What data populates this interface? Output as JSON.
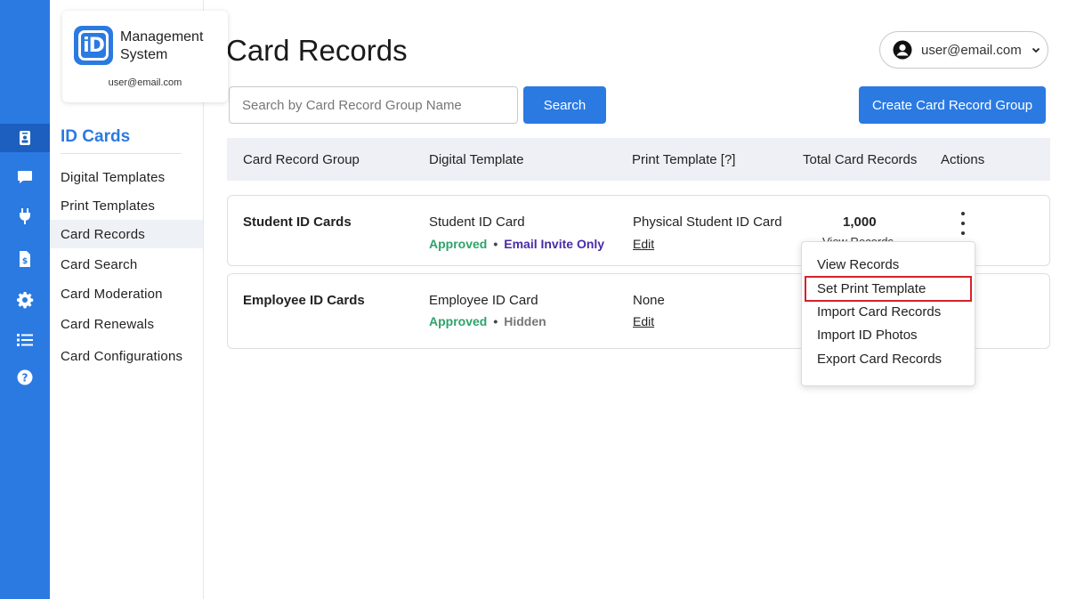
{
  "brand": {
    "name": "Management System",
    "logo_text": "iD",
    "user_email": "user@email.com",
    "accent_color": "#2a7ae2"
  },
  "rail": {
    "items": [
      {
        "icon": "id-badge-icon",
        "active": true
      },
      {
        "icon": "chat-icon",
        "active": false
      },
      {
        "icon": "plug-icon",
        "active": false
      },
      {
        "icon": "invoice-icon",
        "active": false
      },
      {
        "icon": "gear-icon",
        "active": false
      },
      {
        "icon": "list-icon",
        "active": false
      },
      {
        "icon": "help-icon",
        "active": false
      }
    ]
  },
  "sidebar": {
    "section_title": "ID Cards",
    "items": [
      {
        "label": "Digital Templates",
        "active": false
      },
      {
        "label": "Print Templates",
        "active": false
      },
      {
        "label": "Card Records",
        "active": true
      },
      {
        "label": "Card Search",
        "active": false
      },
      {
        "label": "Card Moderation",
        "active": false
      },
      {
        "label": "Card Renewals",
        "active": false
      },
      {
        "label": "Card Configurations",
        "active": false
      }
    ]
  },
  "header": {
    "title": "Card Records",
    "user_email": "user@email.com"
  },
  "search": {
    "placeholder": "Search by Card Record Group Name",
    "value": "",
    "button_label": "Search"
  },
  "create_button_label": "Create Card Record Group",
  "table": {
    "columns": [
      "Card Record Group",
      "Digital Template",
      "Print Template [?]",
      "Total Card Records",
      "Actions"
    ],
    "rows": [
      {
        "group": "Student ID Cards",
        "digital_template": "Student ID Card",
        "status": "Approved",
        "access": "Email Invite Only",
        "print_template": "Physical Student ID Card",
        "edit_label": "Edit",
        "total": "1,000",
        "view_link": "View Records"
      },
      {
        "group": "Employee ID Cards",
        "digital_template": "Employee ID Card",
        "status": "Approved",
        "access": "Hidden",
        "print_template": "None",
        "edit_label": "Edit"
      }
    ]
  },
  "actions_menu": {
    "items": [
      "View Records",
      "Set Print Template",
      "Import Card Records",
      "Import ID Photos",
      "Export Card Records"
    ],
    "highlighted": "Set Print Template"
  }
}
